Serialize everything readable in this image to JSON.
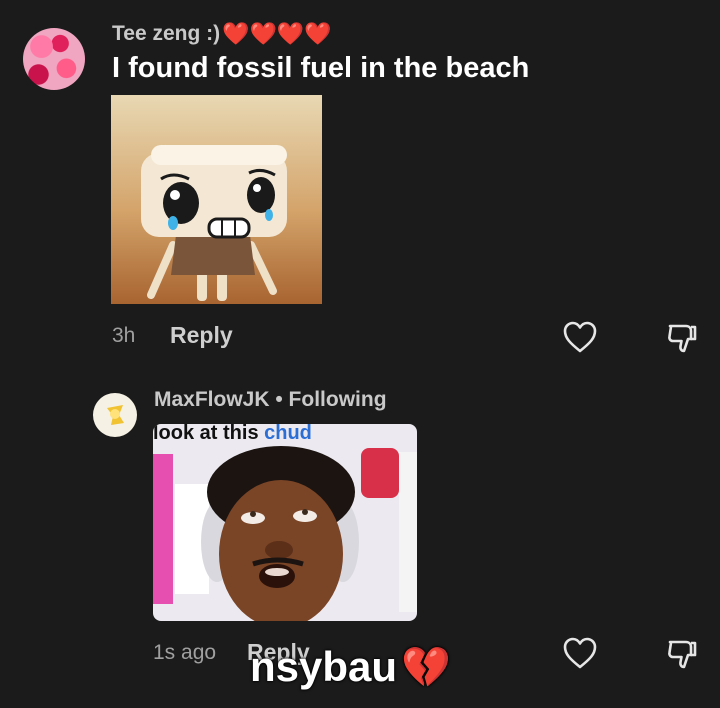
{
  "comments": [
    {
      "username": "Tee zeng :)",
      "username_emoji": "❤️❤️❤️❤️",
      "text": "I found fossil fuel in the beach",
      "time": "3h",
      "reply_label": "Reply"
    },
    {
      "username": "MaxFlowJK • Following",
      "image_caption_prefix": "look at this ",
      "image_caption_highlight": "chud",
      "time": "1s ago",
      "reply_label": "Reply"
    }
  ],
  "overlay": {
    "text": "nsybau",
    "emoji": "💔"
  },
  "icons": {
    "like": "heart-outline-icon",
    "dislike": "thumbs-down-outline-icon"
  },
  "colors": {
    "background": "#1b1b1b",
    "heart_red": "#d0343d",
    "caption_blue": "#2b6fd6"
  }
}
